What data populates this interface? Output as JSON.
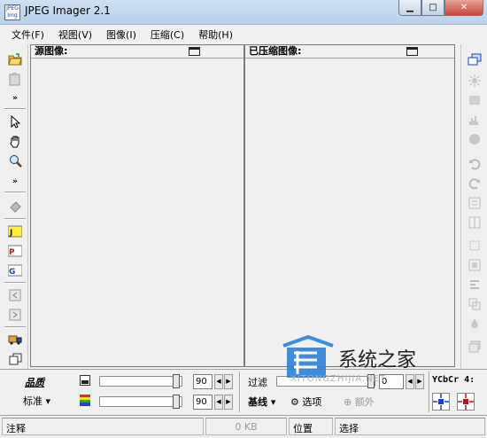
{
  "window": {
    "title": "JPEG Imager 2.1",
    "app_icon_text": "JPEG Img"
  },
  "menu": [
    "文件(F)",
    "视图(V)",
    "图像(I)",
    "压缩(C)",
    "帮助(H)"
  ],
  "panels": {
    "source_label": "源图像:",
    "compressed_label": "已压缩图像:"
  },
  "controls": {
    "quality_label": "品质",
    "preset_value": "标准",
    "slider1_value": "90",
    "slider2_value": "90",
    "filter_label": "过滤",
    "filter_value": "0",
    "baseline_value": "基线",
    "options_label": "选项",
    "extra_label": "额外",
    "chroma_label": "YCbCr 4:"
  },
  "status": {
    "note": "注释",
    "size": "0 KB",
    "position": "位置",
    "selection": "选择"
  },
  "watermark": {
    "brand": "系统之家",
    "url": "XITONGZHIJIA.NET"
  },
  "colors": {
    "title_bar": "#c4d9ee",
    "close_button": "#c7473b",
    "panel_bg": "#f0f0f0"
  }
}
